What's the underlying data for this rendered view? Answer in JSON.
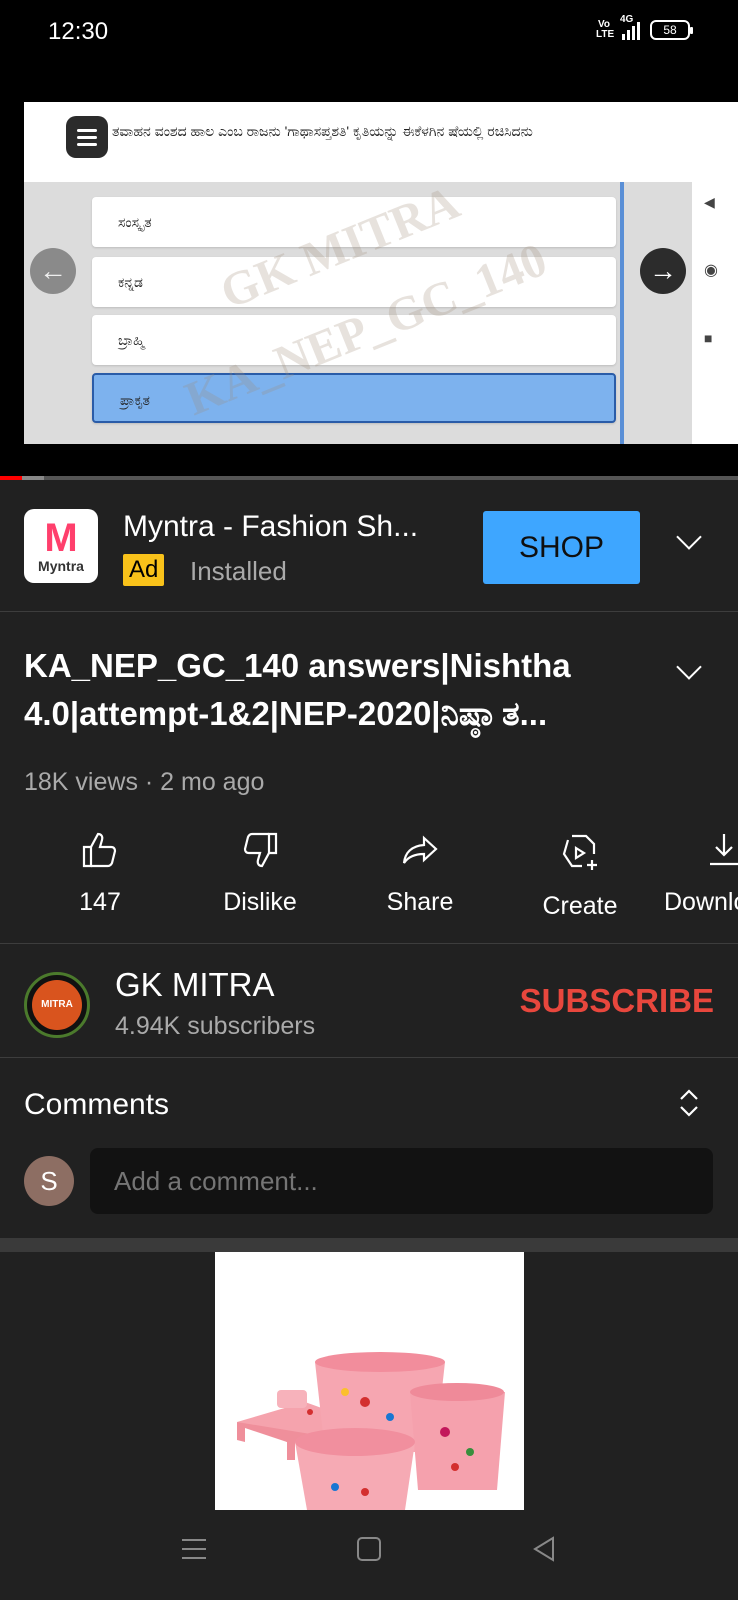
{
  "status": {
    "time": "12:30",
    "volte": "Vo LTE",
    "network": "4G",
    "battery": "58"
  },
  "video": {
    "question_text": "ತವಾಹನ ವಂಶದ ಹಾಲ ಎಂಬ ರಾಜನು 'ಗಾಥಾಸಪ್ತಶತಿ' ಕೃತಿಯನ್ನು ಈಕೆಳಗಿನ ಷೆಯಲ್ಲಿ ರಚಿಸಿದನು",
    "options": [
      "ಸಂಸ್ಕೃತ",
      "ಕನ್ನಡ",
      "ಬ್ರಾಹ್ಮಿ",
      "ಪ್ರಾಕೃತ"
    ],
    "selected_option": 3,
    "watermark_1": "GK MITRA",
    "watermark_2": "KA_NEP_GC_140",
    "progress": 0.03
  },
  "ad": {
    "logo_text": "Myntra",
    "title": "Myntra - Fashion Sh...",
    "badge": "Ad",
    "status": "Installed",
    "cta": "SHOP"
  },
  "video_info": {
    "title": "KA_NEP_GC_140 answers|Nishtha 4.0|attempt-1&2|NEP-2020|ನಿಷ್ಠಾ ತ...",
    "meta": "18K views · 2 mo ago"
  },
  "actions": {
    "like": "147",
    "dislike": "Dislike",
    "share": "Share",
    "create": "Create",
    "download": "Download"
  },
  "channel": {
    "avatar_text": "MITRA",
    "name": "GK MITRA",
    "subscribers": "4.94K subscribers",
    "subscribe": "SUBSCRIBE"
  },
  "comments": {
    "title": "Comments",
    "user_initial": "S",
    "placeholder": "Add a comment..."
  },
  "colors": {
    "background": "#212121",
    "subscribe": "#e8473d",
    "shop_button": "#3ea6ff",
    "ad_badge": "#f9c21a",
    "progress": "#ff0000"
  }
}
